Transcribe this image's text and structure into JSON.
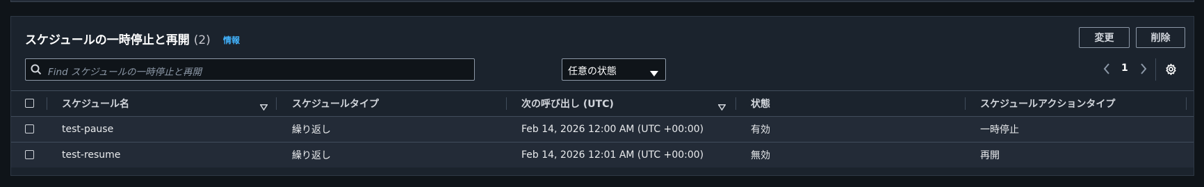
{
  "panel": {
    "title": "スケジュールの一時停止と再開",
    "count": "(2)",
    "info_link": "情報",
    "change_label": "変更",
    "delete_label": "削除"
  },
  "filters": {
    "search_placeholder": "Find スケジュールの一時停止と再開",
    "state_select_value": "任意の状態"
  },
  "pagination": {
    "current_page": "1"
  },
  "table": {
    "columns": [
      "スケジュール名",
      "スケジュールタイプ",
      "次の呼び出し (UTC)",
      "状態",
      "スケジュールアクションタイプ"
    ],
    "rows": [
      {
        "name": "test-pause",
        "type": "繰り返し",
        "next": "Feb 14, 2026 12:00 AM (UTC +00:00)",
        "state": "有効",
        "action": "一時停止"
      },
      {
        "name": "test-resume",
        "type": "繰り返し",
        "next": "Feb 14, 2026 12:01 AM (UTC +00:00)",
        "state": "無効",
        "action": "再開"
      }
    ]
  },
  "icons": [
    "search-icon",
    "caret-down-icon",
    "chevron-left-icon",
    "chevron-right-icon",
    "settings-gear-icon",
    "sort-descending-icon"
  ],
  "colors": {
    "accent_link": "#42b4ff",
    "panel_bg": "#1b232d",
    "row_bg": "#232b37",
    "page_bg": "#0f1419"
  }
}
